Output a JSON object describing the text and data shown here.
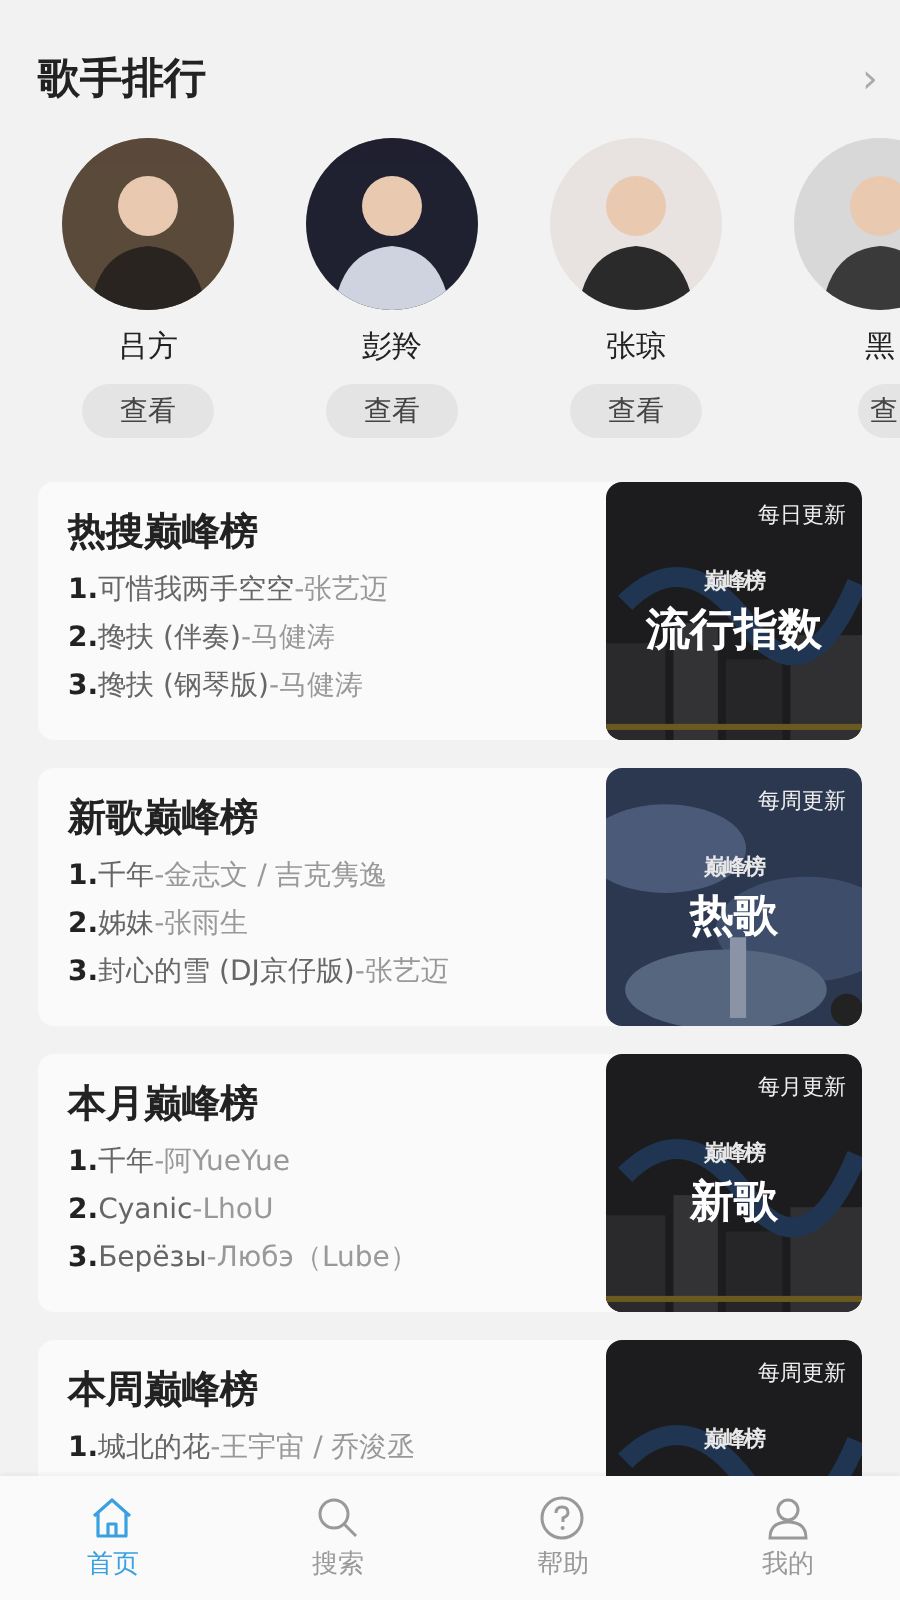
{
  "section": {
    "title": "歌手排行",
    "more": "›"
  },
  "singers": [
    {
      "name": "吕方",
      "action": "查看"
    },
    {
      "name": "彭羚",
      "action": "查看"
    },
    {
      "name": "张琼",
      "action": "查看"
    },
    {
      "name": "黑",
      "action": "查"
    }
  ],
  "charts": [
    {
      "title": "热搜巅峰榜",
      "update": "每日更新",
      "logo": "巅峰榜",
      "cover_title": "流行指数",
      "tracks": [
        {
          "rank": "1.",
          "song": "可惜我两手空空",
          "artist": "-张艺迈"
        },
        {
          "rank": "2.",
          "song": "搀扶 (伴奏)",
          "artist": "-马健涛"
        },
        {
          "rank": "3.",
          "song": "搀扶 (钢琴版)",
          "artist": "-马健涛"
        }
      ]
    },
    {
      "title": "新歌巅峰榜",
      "update": "每周更新",
      "logo": "巅峰榜",
      "cover_title": "热歌",
      "tracks": [
        {
          "rank": "1.",
          "song": "千年",
          "artist": "-金志文 / 吉克隽逸"
        },
        {
          "rank": "2.",
          "song": "姊妹",
          "artist": "-张雨生"
        },
        {
          "rank": "3.",
          "song": "封心的雪 (DJ京仔版)",
          "artist": "-张艺迈"
        }
      ]
    },
    {
      "title": "本月巅峰榜",
      "update": "每月更新",
      "logo": "巅峰榜",
      "cover_title": "新歌",
      "tracks": [
        {
          "rank": "1.",
          "song": "千年",
          "artist": "-阿YueYue"
        },
        {
          "rank": "2.",
          "song": "Cyanic",
          "artist": "-LhoU"
        },
        {
          "rank": "3.",
          "song": "Берёзы",
          "artist": "-Любэ（Lube）"
        }
      ]
    },
    {
      "title": "本周巅峰榜",
      "update": "每周更新",
      "logo": "巅峰榜",
      "tracks": [
        {
          "rank": "1.",
          "song": "城北的花",
          "artist": "-王宇宙 / 乔浚丞"
        }
      ]
    }
  ],
  "nav": [
    {
      "label": "首页",
      "kind": "home",
      "selected": true
    },
    {
      "label": "搜索",
      "kind": "search",
      "selected": false
    },
    {
      "label": "帮助",
      "kind": "help",
      "selected": false
    },
    {
      "label": "我的",
      "kind": "user",
      "selected": false
    }
  ]
}
